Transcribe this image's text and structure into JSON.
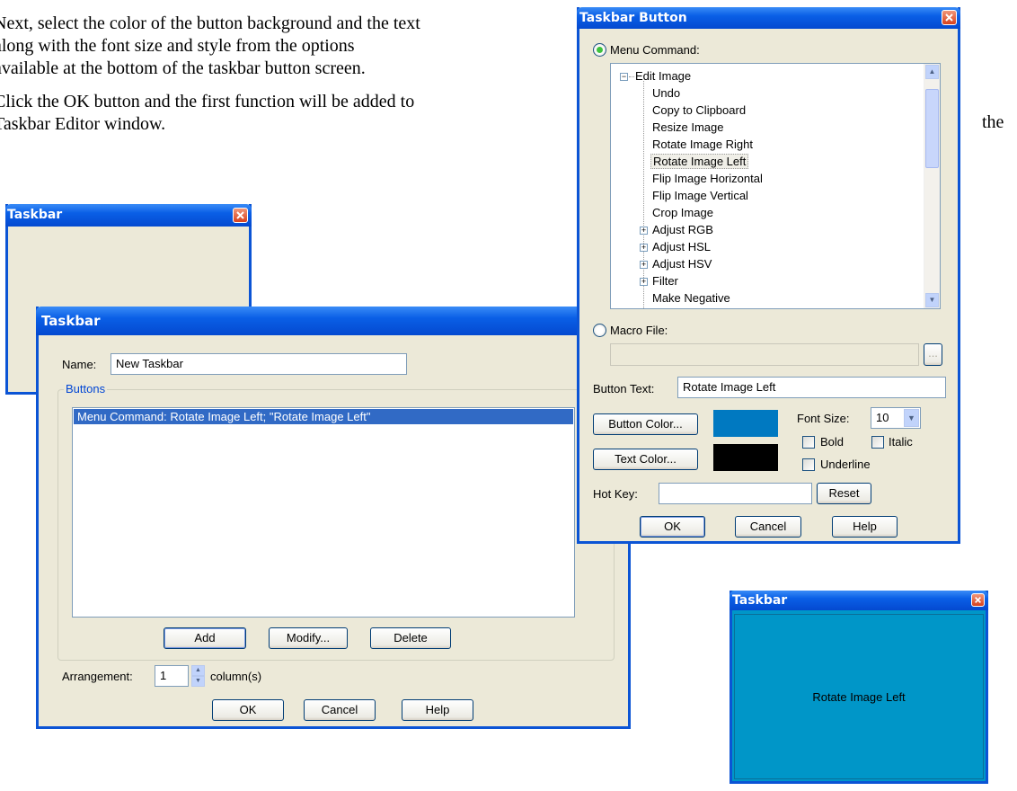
{
  "document": {
    "paragraph1": [
      "Next, select the color of the button background and the text",
      "along with the font size and style from the options",
      "available at the bottom of the taskbar button screen."
    ],
    "paragraph2": [
      "Click the OK button and the first function will be added to",
      "Taskbar Editor window."
    ],
    "trailing_word": "the"
  },
  "taskbar_small": {
    "title": "Taskbar"
  },
  "taskbar_editor": {
    "title": "Taskbar",
    "name_label": "Name:",
    "name_value": "New Taskbar",
    "buttons_group": "Buttons",
    "list_items": [
      "Menu Command: Rotate Image Left; \"Rotate Image Left\""
    ],
    "add_label": "Add",
    "modify_label": "Modify...",
    "delete_label": "Delete",
    "arrangement_label": "Arrangement:",
    "arrangement_value": "1",
    "columns_label": "column(s)",
    "ok_label": "OK",
    "cancel_label": "Cancel",
    "help_label": "Help"
  },
  "taskbar_button": {
    "title": "Taskbar Button",
    "menu_command_label": "Menu Command:",
    "tree": {
      "root": "Edit Image",
      "items": [
        "Undo",
        "Copy to Clipboard",
        "Resize Image",
        "Rotate Image Right",
        "Rotate Image Left",
        "Flip Image Horizontal",
        "Flip Image Vertical",
        "Crop Image",
        "Adjust RGB",
        "Adjust HSL",
        "Adjust HSV",
        "Filter",
        "Make Negative"
      ],
      "selected": "Rotate Image Left"
    },
    "macro_file_label": "Macro File:",
    "browse_label": "...",
    "button_text_label": "Button Text:",
    "button_text_value": "Rotate Image Left",
    "button_color_label": "Button Color...",
    "text_color_label": "Text Color...",
    "font_size_label": "Font Size:",
    "font_size_value": "10",
    "bold_label": "Bold",
    "italic_label": "Italic",
    "underline_label": "Underline",
    "hotkey_label": "Hot Key:",
    "reset_label": "Reset",
    "ok_label": "OK",
    "cancel_label": "Cancel",
    "help_label": "Help",
    "button_color": "#0079c1",
    "text_color": "#000000"
  },
  "taskbar_preview": {
    "title": "Taskbar",
    "button_label": "Rotate Image Left",
    "background": "#0096c8"
  }
}
